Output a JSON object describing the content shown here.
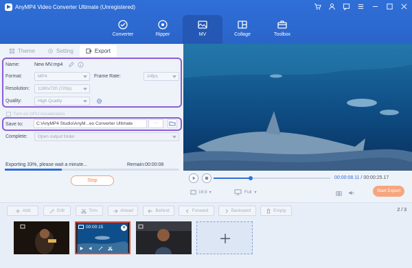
{
  "app": {
    "title": "AnyMP4 Video Converter Ultimate (Unregistered)",
    "accent": "#2a64c9",
    "window_icons": [
      "cart-icon",
      "profile-icon",
      "feedback-icon",
      "menu-icon",
      "minimize-icon",
      "maximize-icon",
      "close-icon"
    ]
  },
  "nav": {
    "tabs": [
      {
        "label": "Converter",
        "icon": "converter-icon"
      },
      {
        "label": "Ripper",
        "icon": "ripper-icon"
      },
      {
        "label": "MV",
        "icon": "mv-icon",
        "active": true
      },
      {
        "label": "Collage",
        "icon": "collage-icon"
      },
      {
        "label": "Toolbox",
        "icon": "toolbox-icon"
      }
    ]
  },
  "subtabs": {
    "theme": "Theme",
    "setting": "Setting",
    "export": "Export",
    "active": "Export"
  },
  "export": {
    "name_label": "Name:",
    "name_value": "New MV.mp4",
    "format_label": "Format:",
    "format_value": "MP4",
    "framerate_label": "Frame Rate:",
    "framerate_value": "24fps",
    "resolution_label": "Resolution:",
    "resolution_value": "1280x720 (720p)",
    "quality_label": "Quality:",
    "quality_value": "High Quality",
    "gpu_label": "Turn on GPU Acceleration",
    "saveto_label": "Save to:",
    "saveto_value": "C:\\AnyMP4 Studio\\AnyM...eo Converter Ultimate",
    "dots": "···",
    "complete_label": "Complete:",
    "complete_value": "Open output folder",
    "progress_text": "Exporting 33%, please wait a minute...",
    "progress": 0.33,
    "remain": "Remain:00:00:08",
    "stop": "Stop"
  },
  "player": {
    "time_current": "00:00:08.11",
    "time_total": "00:00:25.17",
    "seek": 0.32,
    "ratio": "16:9",
    "zoom": "Full",
    "start_export": "Start Export"
  },
  "toolbar": {
    "add": "Add",
    "edit": "Edit",
    "trim": "Trim",
    "ahead": "Ahead",
    "behind": "Behind",
    "forward": "Forward",
    "backward": "Backward",
    "empty": "Empty",
    "page": "2 / 3"
  },
  "timeline": {
    "active_clip_time": "00:00:15"
  }
}
